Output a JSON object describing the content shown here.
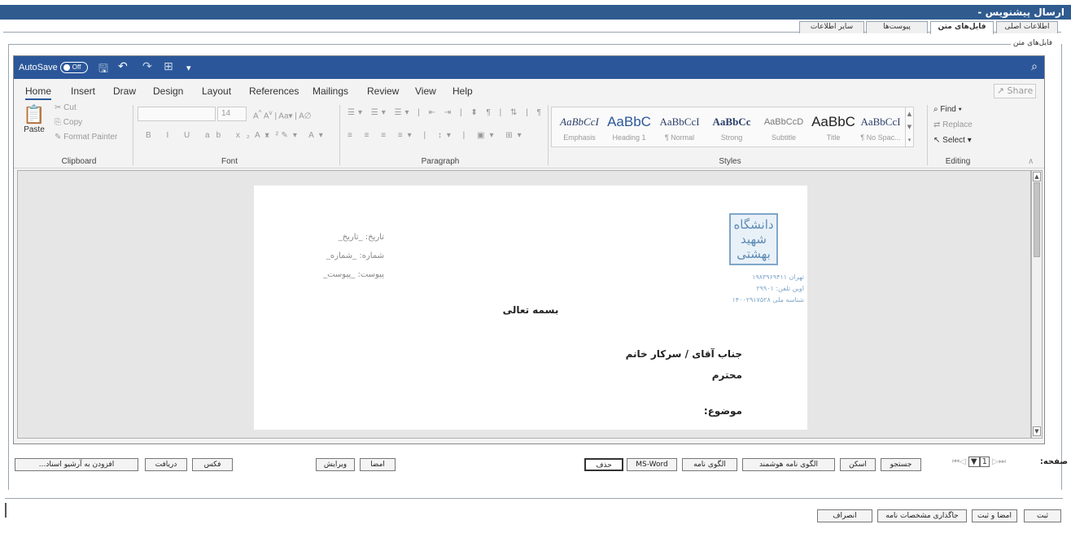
{
  "window": {
    "title": "ارسال پیشنویس -"
  },
  "tabs": [
    {
      "label": "اطلاعات اصلی"
    },
    {
      "label": "فایل‌های متن"
    },
    {
      "label": "پیوست‌ها"
    },
    {
      "label": "سایر اطلاعات"
    }
  ],
  "group_label": "فایل‌های متن",
  "word": {
    "autosave_label": "AutoSave",
    "autosave_state": "Off",
    "menu": [
      "Home",
      "Insert",
      "Draw",
      "Design",
      "Layout",
      "References",
      "Mailings",
      "Review",
      "View",
      "Help"
    ],
    "share_label": "Share",
    "clipboard": {
      "paste": "Paste",
      "cut": "Cut",
      "copy": "Copy",
      "format_painter": "Format Painter",
      "label": "Clipboard"
    },
    "font": {
      "size": "14",
      "label": "Font"
    },
    "paragraph_label": "Paragraph",
    "styles": [
      {
        "preview": "AaBbCcI",
        "name": "Emphasis"
      },
      {
        "preview": "AaBbC",
        "name": "Heading 1"
      },
      {
        "preview": "AaBbCcI",
        "name": "¶ Normal"
      },
      {
        "preview": "AaBbCc",
        "name": "Strong"
      },
      {
        "preview": "AaBbCcD",
        "name": "Subtitle"
      },
      {
        "preview": "AaBbC",
        "name": "Title"
      },
      {
        "preview": "AaBbCcI",
        "name": "¶ No Spac..."
      }
    ],
    "styles_label": "Styles",
    "editing": {
      "find": "Find",
      "replace": "Replace",
      "select": "Select",
      "label": "Editing"
    }
  },
  "document": {
    "date_line": "تاریخ: _تاریخ_",
    "number_line": "شماره: _شماره_",
    "attachment_line": "پیوست: _پیوست_",
    "logo_text": "دانشگاه شهید بهشتی",
    "address_1": "تهران ۱۹۸۳۹۶۹۴۱۱",
    "address_2": "اوین تلفن: ۲۹۹۰۱",
    "address_3": "شناسه ملی ۱۴۰۰۲۹۱۷۵۲۸",
    "bismillah": "بسمه تعالی",
    "salutation": "جناب آقای / سرکار خانم",
    "respected": "محترم",
    "subject": "موضوع:"
  },
  "toolbar_buttons": {
    "archive": "افزودن به آرشیو اسناد...",
    "receive": "دریافت",
    "fax": "فکس",
    "edit": "ویرایش",
    "sign": "امضا",
    "delete": "حذف",
    "ms_word": "MS-Word",
    "letter_template": "الگوی نامه",
    "smart_template": "الگوی نامه هوشمند",
    "scan": "اسکن",
    "search": "جستجو"
  },
  "pager": {
    "label": "صفحه:",
    "current": "1"
  },
  "footer_buttons": {
    "submit": "ثبت",
    "sign_submit": "امضا و ثبت",
    "placement": "جاگذاری مشخصات نامه",
    "cancel": "انصراف"
  }
}
